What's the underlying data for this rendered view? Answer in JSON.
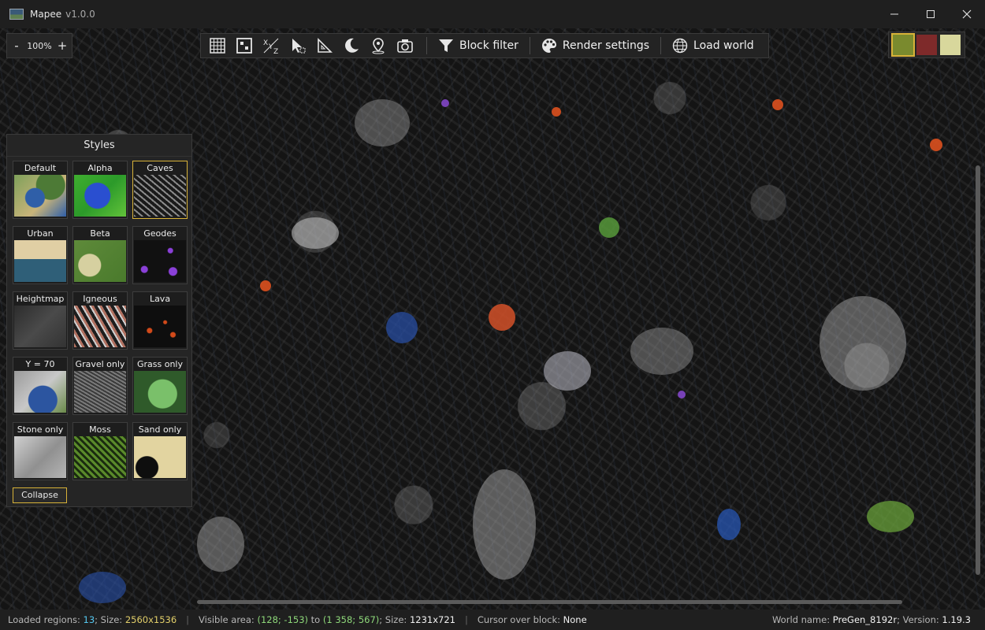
{
  "window": {
    "title": "Mapee",
    "version": "v1.0.0",
    "minimize_icon": "minimize-icon",
    "maximize_icon": "maximize-icon",
    "close_icon": "close-icon"
  },
  "zoom": {
    "minus": "-",
    "value": "100%",
    "plus": "+"
  },
  "toolbar": {
    "tools": [
      {
        "icon": "grid-icon"
      },
      {
        "icon": "region-grid-icon"
      },
      {
        "icon": "coordinates-xyz-icon"
      },
      {
        "icon": "select-cursor-icon"
      },
      {
        "icon": "ruler-icon"
      },
      {
        "icon": "moon-icon"
      },
      {
        "icon": "location-pin-icon"
      },
      {
        "icon": "camera-icon"
      }
    ],
    "block_filter": "Block filter",
    "render_settings": "Render settings",
    "load_world": "Load world"
  },
  "swatches": [
    {
      "name": "grass",
      "color": "#7a8a2e",
      "selected": true
    },
    {
      "name": "netherrack",
      "color": "#7e2a2a",
      "selected": false
    },
    {
      "name": "end-stone",
      "color": "#d8d79c",
      "selected": false
    }
  ],
  "styles_panel": {
    "title": "Styles",
    "collapse_label": "Collapse",
    "items": [
      {
        "label": "Default",
        "selected": false
      },
      {
        "label": "Alpha",
        "selected": false
      },
      {
        "label": "Caves",
        "selected": true
      },
      {
        "label": "Urban",
        "selected": false
      },
      {
        "label": "Beta",
        "selected": false
      },
      {
        "label": "Geodes",
        "selected": false
      },
      {
        "label": "Heightmap",
        "selected": false
      },
      {
        "label": "Igneous",
        "selected": false
      },
      {
        "label": "Lava",
        "selected": false
      },
      {
        "label": "Y = 70",
        "selected": false
      },
      {
        "label": "Gravel only",
        "selected": false
      },
      {
        "label": "Grass only",
        "selected": false
      },
      {
        "label": "Stone only",
        "selected": false
      },
      {
        "label": "Moss",
        "selected": false
      },
      {
        "label": "Sand only",
        "selected": false
      }
    ]
  },
  "status": {
    "loaded_regions_label": "Loaded regions:",
    "loaded_regions": "13",
    "size_label": "; Size:",
    "size": "2560x1536",
    "visible_area_label": "Visible area:",
    "from": "(128; -153)",
    "to_label": "to",
    "to": "(1 358; 567)",
    "visible_size_label": "; Size:",
    "visible_size": "1231x721",
    "cursor_label": "Cursor over block:",
    "cursor_value": "None",
    "world_name_label": "World name:",
    "world_name": "PreGen_8192r",
    "version_label": "; Version:",
    "version": "1.19.3"
  }
}
